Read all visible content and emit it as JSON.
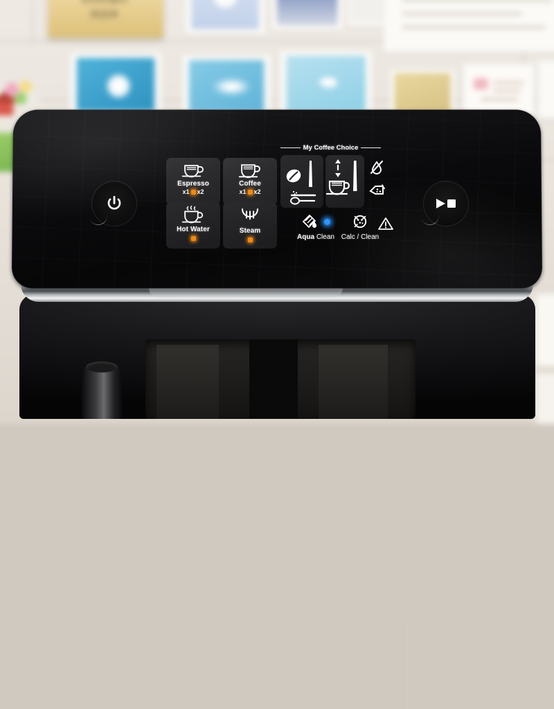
{
  "scene": {
    "subject": "espresso-machine-control-panel",
    "description": "Philips fully automatic espresso machine top control panel photographed against a blurred white brick wall with framed artwork"
  },
  "background": {
    "wall_color": "#eae4dd",
    "sign_text_1": "你們所要的",
    "sign_text_2": "將話神",
    "sign_color": "#e8cf8f",
    "frames": [
      {
        "name": "frame-blue-swirl",
        "color": "#c7d4ea"
      },
      {
        "name": "frame-daisy",
        "color": "#49aed4"
      },
      {
        "name": "frame-blossom",
        "color": "#7fc4e3"
      },
      {
        "name": "frame-seascape",
        "color": "#8fa4c6"
      },
      {
        "name": "frame-handwriting",
        "color": "#f6f4ef"
      },
      {
        "name": "frame-bird",
        "color": "#a8d8e8"
      },
      {
        "name": "frame-note-yellow",
        "color": "#e3d39a"
      },
      {
        "name": "frame-note-pink",
        "color": "#f7f5f1"
      }
    ]
  },
  "panel": {
    "power_button": {
      "label": "power",
      "icon": "power-icon"
    },
    "start_stop_button": {
      "label": "start / stop",
      "icon": "play-stop-icon"
    },
    "section_title": "My Coffee Choice",
    "drinks": [
      {
        "name": "espresso",
        "label": "Espresso",
        "icon": "espresso-cup-icon",
        "sub_left": "x1",
        "sub_right": "x2",
        "led_color": "#f08a12",
        "led_on": true
      },
      {
        "name": "coffee",
        "label": "Coffee",
        "icon": "coffee-cup-icon",
        "sub_left": "x1",
        "sub_right": "x2",
        "led_color": "#f08a12",
        "led_on": true
      },
      {
        "name": "hot-water",
        "label": "Hot Water",
        "icon": "hot-water-cup-icon",
        "led_color": "#f08a12",
        "led_on": true
      },
      {
        "name": "steam",
        "label": "Steam",
        "icon": "steam-icon",
        "led_color": "#f08a12",
        "led_on": true
      }
    ],
    "adjusters": [
      {
        "name": "bean-strength",
        "icon": "coffee-bean-icon",
        "secondary_icon": "ground-coffee-spoon-icon",
        "slider": "vertical-bar"
      },
      {
        "name": "cup-volume",
        "icon": "cup-volume-icon",
        "arrows": "up-down-arrows-icon",
        "slider": "vertical-bar"
      }
    ],
    "maintenance": [
      {
        "name": "aqua-clean",
        "label_bold": "Aqua",
        "label_light": "Clean",
        "icon": "water-filter-icon",
        "led_color": "#2a96ff",
        "led_on": true
      },
      {
        "name": "calc-clean",
        "label": "Calc / Clean",
        "icon": "descale-icon",
        "led_on": false
      }
    ],
    "status_icons": [
      {
        "name": "no-water-icon",
        "meaning": "water tank empty"
      },
      {
        "name": "coffee-grounds-container-icon",
        "meaning": "empty grounds container"
      },
      {
        "name": "warning-triangle-icon",
        "meaning": "general alert"
      }
    ]
  }
}
